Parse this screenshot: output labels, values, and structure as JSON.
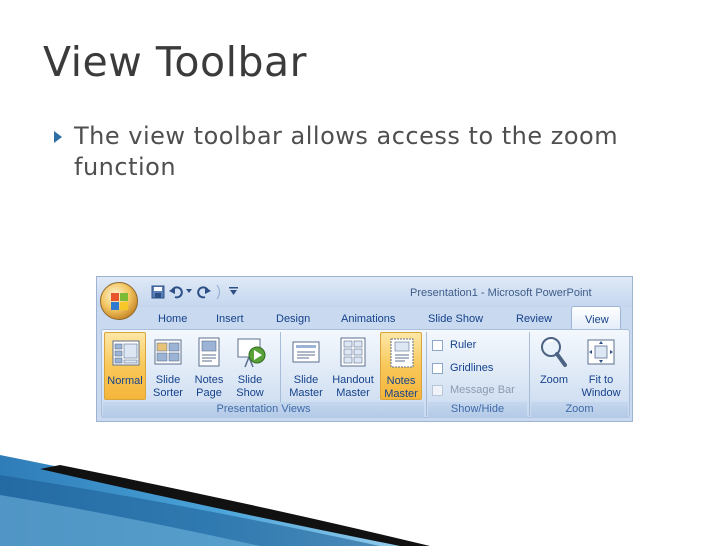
{
  "slide": {
    "title": "View Toolbar",
    "bullet": "The view toolbar allows access to the zoom function"
  },
  "ribbon": {
    "window_title": "Presentation1 - Microsoft PowerPoint",
    "tabs": [
      "Home",
      "Insert",
      "Design",
      "Animations",
      "Slide Show",
      "Review",
      "View"
    ],
    "active_tab": "View",
    "groups": {
      "presentation_views": {
        "label": "Presentation Views",
        "buttons": [
          {
            "line1": "Normal",
            "line2": "",
            "icon": "normal-view-icon"
          },
          {
            "line1": "Slide",
            "line2": "Sorter",
            "icon": "slide-sorter-icon"
          },
          {
            "line1": "Notes",
            "line2": "Page",
            "icon": "notes-page-icon"
          },
          {
            "line1": "Slide",
            "line2": "Show",
            "icon": "slide-show-icon"
          },
          {
            "line1": "Slide",
            "line2": "Master",
            "icon": "slide-master-icon"
          },
          {
            "line1": "Handout",
            "line2": "Master",
            "icon": "handout-master-icon"
          },
          {
            "line1": "Notes",
            "line2": "Master",
            "icon": "notes-master-icon"
          }
        ]
      },
      "show_hide": {
        "label": "Show/Hide",
        "items": [
          {
            "label": "Ruler",
            "enabled": true
          },
          {
            "label": "Gridlines",
            "enabled": true
          },
          {
            "label": "Message Bar",
            "enabled": false
          }
        ]
      },
      "zoom": {
        "label": "Zoom",
        "buttons": [
          {
            "line1": "Zoom",
            "line2": "",
            "icon": "magnifier-icon"
          },
          {
            "line1": "Fit to",
            "line2": "Window",
            "icon": "fit-to-window-icon"
          }
        ]
      }
    },
    "colors": {
      "ribbon_text": "#15428b",
      "active_button": "#f8c85a",
      "ribbon_background": "#c9d9ef"
    }
  }
}
